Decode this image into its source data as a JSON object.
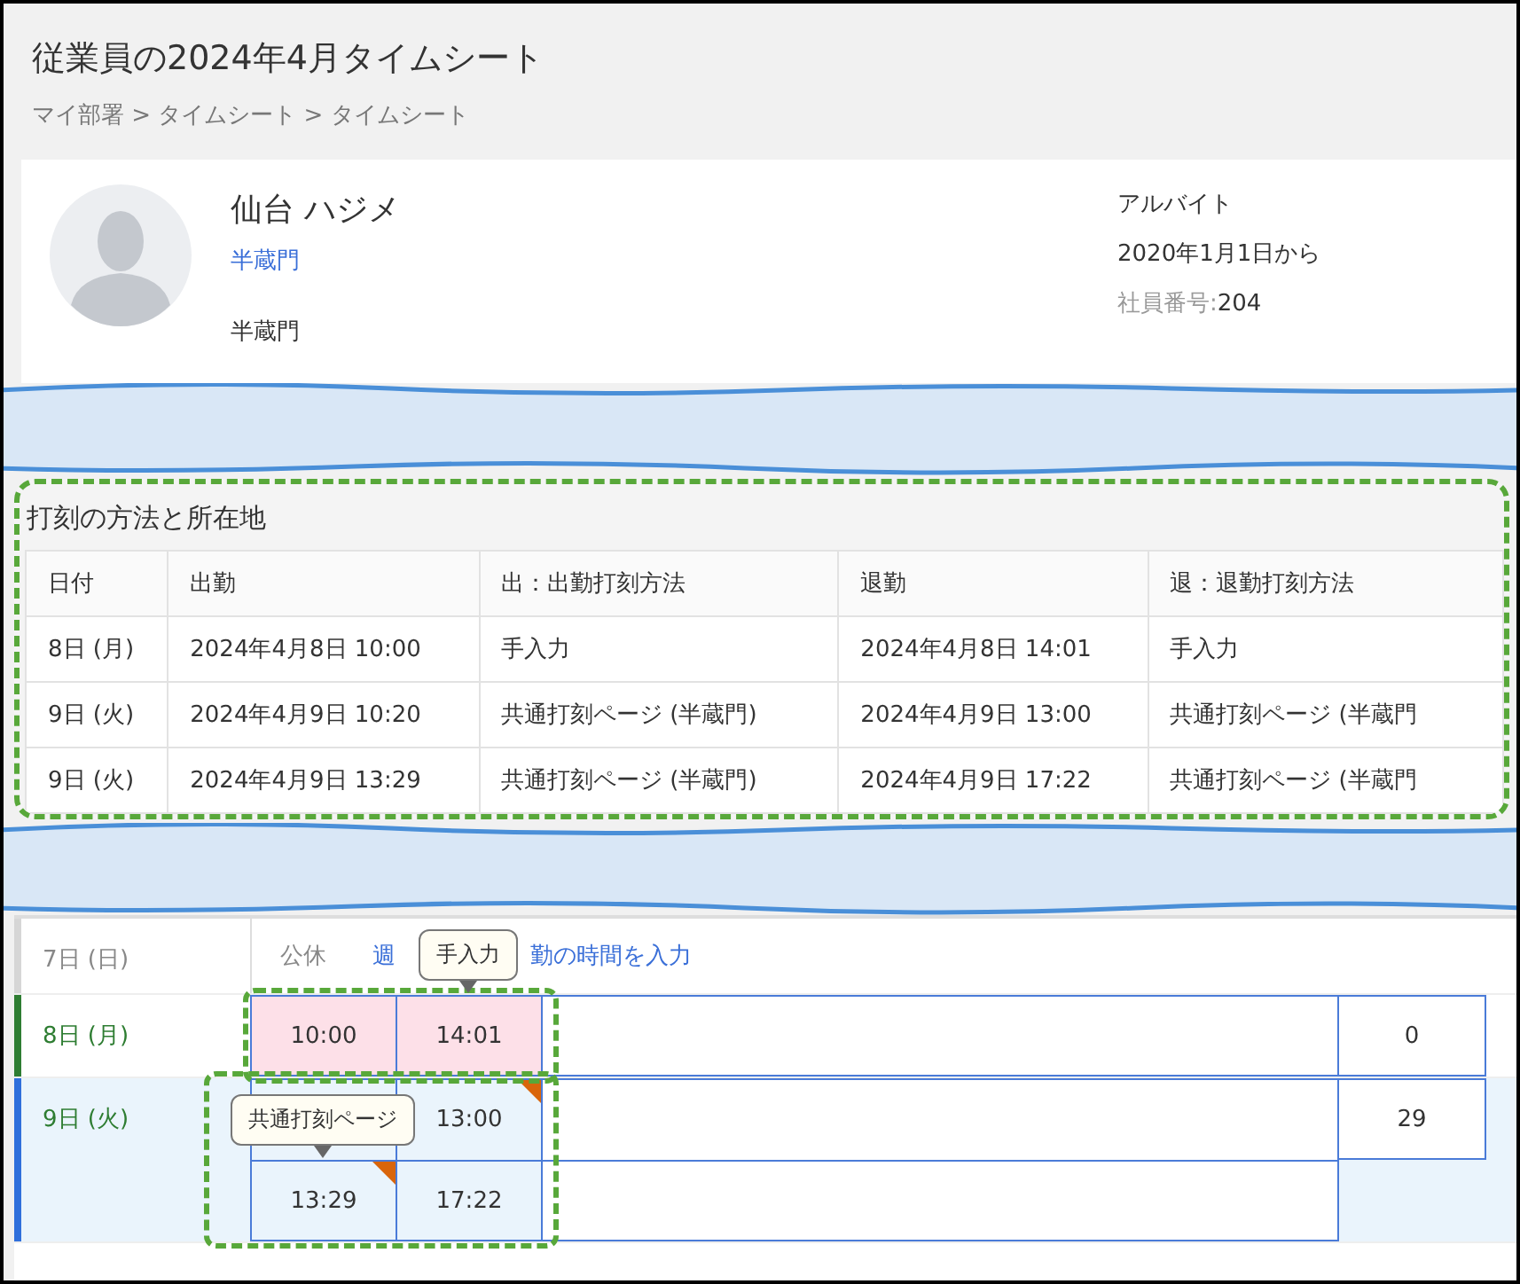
{
  "title": "従業員の2024年4月タイムシート",
  "breadcrumb": "マイ部署 > タイムシート > タイムシート",
  "profile": {
    "name": "仙台 ハジメ",
    "department_link": "半蔵門",
    "location": "半蔵門",
    "role": "アルバイト",
    "since": "2020年1月1日から",
    "employee_no_label": "社員番号:",
    "employee_no": "204"
  },
  "punch_section": {
    "title": "打刻の方法と所在地",
    "columns": [
      "日付",
      "出勤",
      "出：出勤打刻方法",
      "退勤",
      "退：退勤打刻方法"
    ],
    "rows": [
      [
        "8日 (月)",
        "2024年4月8日 10:00",
        "手入力",
        "2024年4月8日 14:01",
        "手入力"
      ],
      [
        "9日 (火)",
        "2024年4月9日 10:20",
        "共通打刻ページ (半蔵門)",
        "2024年4月9日 13:00",
        "共通打刻ページ (半蔵門"
      ],
      [
        "9日 (火)",
        "2024年4月9日 13:29",
        "共通打刻ページ (半蔵門)",
        "2024年4月9日 17:22",
        "共通打刻ページ (半蔵門"
      ]
    ]
  },
  "timesheet": {
    "rows": [
      {
        "kind": "holiday",
        "date": "7日 (日)",
        "color": "#d6d6d6",
        "selected": false,
        "label": "公休",
        "link_before": "週",
        "link_after": "勤の時間を入力"
      },
      {
        "kind": "work",
        "date": "8日 (月)",
        "color": "#2e7d32",
        "selected": false,
        "highlighted": true,
        "entries": [
          {
            "in": "10:00",
            "out": "14:01",
            "manual": true,
            "in_flag": false,
            "out_flag": false,
            "out_tooltip": "手入力",
            "total": "0"
          }
        ]
      },
      {
        "kind": "work",
        "date": "9日 (火)",
        "color": "#2f6fdb",
        "selected": true,
        "highlighted": true,
        "entries": [
          {
            "out": "13:00",
            "manual": false,
            "in_flag": false,
            "out_flag": true,
            "total": "29"
          },
          {
            "in": "13:29",
            "out": "17:22",
            "manual": false,
            "in_flag": true,
            "out_flag": false,
            "in_tooltip": "共通打刻ページ"
          }
        ]
      }
    ]
  }
}
